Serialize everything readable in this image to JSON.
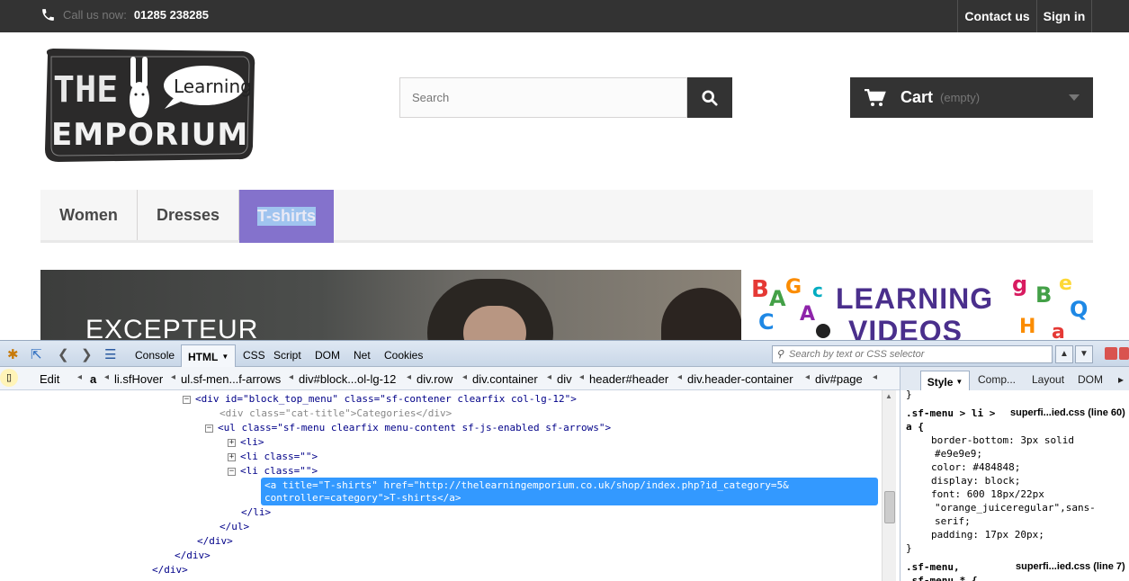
{
  "topbar": {
    "phone_prefix": "Call us now:",
    "phone": "01285 238285",
    "contact": "Contact us",
    "signin": "Sign in"
  },
  "logo": {
    "line1": "THE",
    "line2": "EMPORIUM",
    "speech": "Learning"
  },
  "search": {
    "placeholder": "Search"
  },
  "cart": {
    "label": "Cart",
    "status": "(empty)"
  },
  "menu": {
    "items": [
      "Women",
      "Dresses",
      "T-shirts"
    ]
  },
  "banner": {
    "left_text": "EXCEPTEUR",
    "right_line1": "LEARNING",
    "right_line2": "VIDEOS"
  },
  "firebug": {
    "tabs": [
      "Console",
      "HTML",
      "CSS",
      "Script",
      "DOM",
      "Net",
      "Cookies"
    ],
    "search_placeholder": "Search by text or CSS selector",
    "edit": "Edit",
    "breadcrumbs": [
      "a",
      "li.sfHover",
      "ul.sf-men...f-arrows",
      "div#block...ol-lg-12",
      "div.row",
      "div.container",
      "div",
      "header#header",
      "div.header-container",
      "div#page"
    ],
    "side_tabs": [
      "Style",
      "Comp...",
      "Layout",
      "DOM"
    ],
    "html_lines": [
      "<div id=\"block_top_menu\" class=\"sf-contener clearfix col-lg-12\">",
      "<div class=\"cat-title\">Categories</div>",
      "<ul class=\"sf-menu clearfix menu-content sf-js-enabled sf-arrows\">",
      "<li>",
      "<li class=\"\">",
      "<li class=\"\">",
      "<a title=\"T-shirts\" href=\"http://thelearningemporium.co.uk/shop/index.php?id_category=5&\ncontroller=category\">T-shirts</a>",
      "</li>",
      "</ul>",
      "</div>",
      "</div>",
      "</div>"
    ],
    "css": {
      "rule1_selector": ".sf-menu > li >",
      "rule1_selector2": "a {",
      "rule1_source": "superfi...ied.css (line 60)",
      "rule1_props": [
        "border-bottom: 3px solid",
        "#e9e9e9;",
        "color: #484848;",
        "display: block;",
        "font: 600 18px/22px",
        "\"orange_juiceregular\",sans-",
        "serif;",
        "padding: 17px 20px;"
      ],
      "close": "}",
      "rule2_selector": ".sf-menu,",
      "rule2_selector2": ".sf-menu * {",
      "rule2_source": "superfi...ied.css (line 7)"
    }
  }
}
